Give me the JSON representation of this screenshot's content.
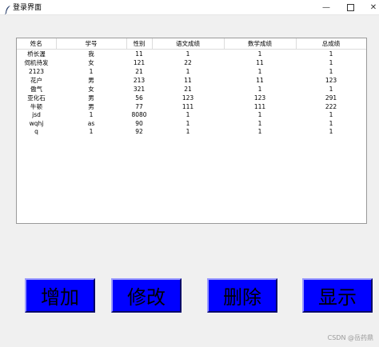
{
  "window": {
    "title": "登录界面",
    "controls": {
      "minimize": "—",
      "maximize": "",
      "close": "✕"
    },
    "icon": "feather-icon"
  },
  "table": {
    "columns": [
      "姓名",
      "学号",
      "性别",
      "语文成绩",
      "数学成绩",
      "总成绩"
    ],
    "rows": [
      [
        "桥长渥",
        "我",
        "11",
        "1",
        "1",
        "1"
      ],
      [
        "伺机待发",
        "女",
        "121",
        "22",
        "11",
        "1"
      ],
      [
        "2123",
        "1",
        "21",
        "1",
        "1",
        "1"
      ],
      [
        "花户",
        "男",
        "213",
        "11",
        "11",
        "123"
      ],
      [
        "傲气",
        "女",
        "321",
        "21",
        "1",
        "1"
      ],
      [
        "亚化石",
        "男",
        "56",
        "123",
        "123",
        "291"
      ],
      [
        "牛顿",
        "男",
        "77",
        "111",
        "111",
        "222"
      ],
      [
        "jsd",
        "1",
        "8080",
        "1",
        "1",
        "1"
      ],
      [
        "wqhj",
        "as",
        "90",
        "1",
        "1",
        "1"
      ],
      [
        "q",
        "1",
        "92",
        "1",
        "1",
        "1"
      ]
    ]
  },
  "buttons": {
    "add": "增加",
    "edit": "修改",
    "delete": "删除",
    "show": "显示"
  },
  "watermark": "CSDN @岳药鼎",
  "colors": {
    "button_bg": "#0000ff",
    "window_bg": "#f0f0f0"
  }
}
